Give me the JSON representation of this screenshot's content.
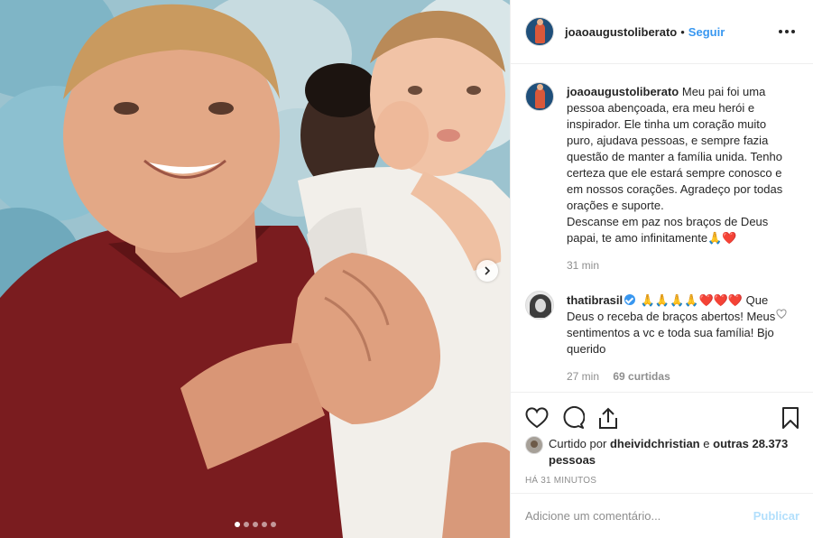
{
  "header": {
    "username": "joaoaugustoliberato",
    "separator": "•",
    "follow_label": "Seguir"
  },
  "caption": {
    "username": "joaoaugustoliberato",
    "text": "Meu pai foi uma pessoa abençoada, era meu herói e inspirador. Ele tinha um coração muito puro, ajudava pessoas, e sempre fazia questão de manter a família unida. Tenho certeza que ele estará sempre conosco e em nossos corações. Agradeço por todas orações e suporte.\nDescanse em paz nos braços de Deus papai, te amo infinitamente🙏❤️",
    "time": "31 min"
  },
  "comments": [
    {
      "username": "thatibrasil",
      "verified": true,
      "text": "🙏🙏🙏🙏❤️❤️❤️ Que Deus o receba de braços abertos! Meus sentimentos a vc e toda sua família! Bjo querido",
      "time": "27 min",
      "likes": "69 curtidas"
    }
  ],
  "likes": {
    "prefix": "Curtido por",
    "user": "dheividchristian",
    "conj": "e",
    "others": "outras 28.373 pessoas"
  },
  "timestamp": "HÁ 31 MINUTOS",
  "add_comment": {
    "placeholder": "Adicione um comentário...",
    "publish_label": "Publicar"
  },
  "carousel": {
    "count": 5,
    "active": 0
  },
  "colors": {
    "accent": "#3897f0",
    "publish_disabled": "#b2dffc",
    "muted": "#8e8e8e"
  }
}
